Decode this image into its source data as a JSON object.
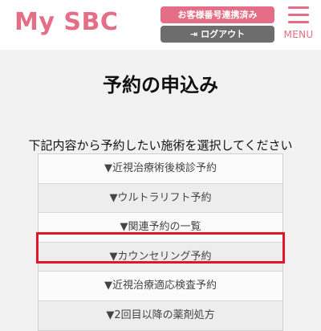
{
  "header": {
    "logo": "My SBC",
    "linked_button": "お客様番号連携済み",
    "logout_icon": "logout-icon",
    "logout_button": "ログアウト",
    "menu_label": "MENU",
    "accent_color": "#e46e86"
  },
  "main": {
    "title": "予約の申込み",
    "instruction": "下記内容から予約したい施術を選択してください",
    "options": [
      "▼近視治療術後検診予約",
      "▼ウルトラリフト予約",
      "▼関連予約の一覧",
      "▼カウンセリング予約",
      "▼近視治療適応検査予約",
      "▼2回目以降の薬剤処方"
    ],
    "highlight_color": "#e0162b"
  }
}
